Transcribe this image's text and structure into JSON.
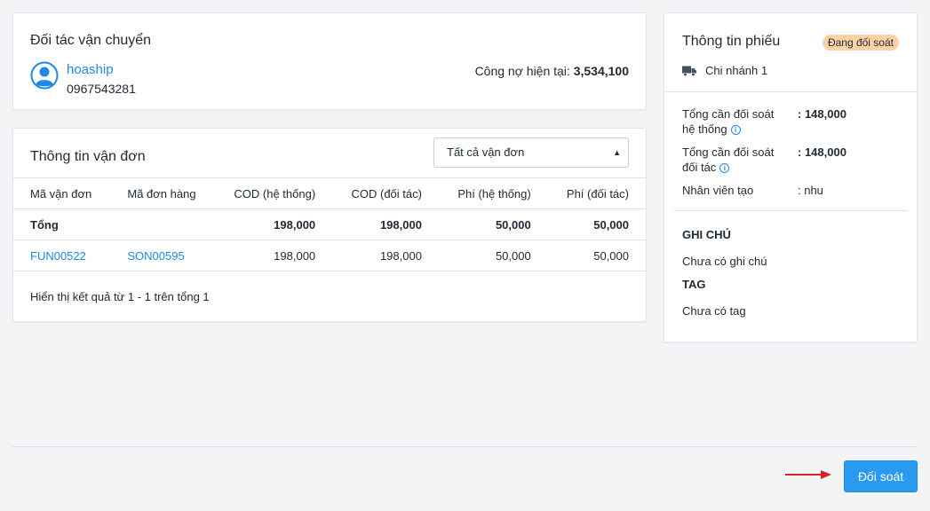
{
  "partner": {
    "title": "Đối tác vận chuyển",
    "name": "hoaship",
    "phone": "0967543281",
    "debt_label": "Công nợ hiện tại:",
    "debt_value": "3,534,100"
  },
  "waybill": {
    "title": "Thông tin vận đơn",
    "filter": {
      "selected": "Tất cả vận đơn"
    },
    "columns": [
      "Mã vận đơn",
      "Mã đơn hàng",
      "COD (hệ thống)",
      "COD (đối tác)",
      "Phí (hệ thống)",
      "Phí (đối tác)"
    ],
    "total_row": [
      "Tổng",
      "",
      "198,000",
      "198,000",
      "50,000",
      "50,000"
    ],
    "rows": [
      [
        "FUN00522",
        "SON00595",
        "198,000",
        "198,000",
        "50,000",
        "50,000"
      ]
    ],
    "summary": "Hiển thị kết quả từ 1 - 1 trên tổng 1"
  },
  "info": {
    "title": "Thông tin phiếu",
    "status_badge": "Đang đối soát",
    "branch": "Chi nhánh 1",
    "system_total_label": "Tổng cần đối soát hệ thống",
    "system_total_value": ": 148,000",
    "partner_total_label": "Tổng cần đối soát đối tác",
    "partner_total_value": ": 148,000",
    "creator_label": "Nhân viên tạo",
    "creator_value": ": nhu",
    "note_heading": "GHI CHÚ",
    "note_value": "Chưa có ghi chú",
    "tag_heading": "TAG",
    "tag_value": "Chưa có tag"
  },
  "footer": {
    "submit_label": "Đối soát"
  },
  "colors": {
    "accent": "#1e88e5",
    "button": "#2a9af0",
    "badge": "#fcd1a4",
    "arrow": "#e02020"
  },
  "icons": {
    "avatar": "user-circle-icon",
    "branch": "truck-icon",
    "info": "info-circle-icon",
    "arrow": "arrow-right-icon"
  }
}
